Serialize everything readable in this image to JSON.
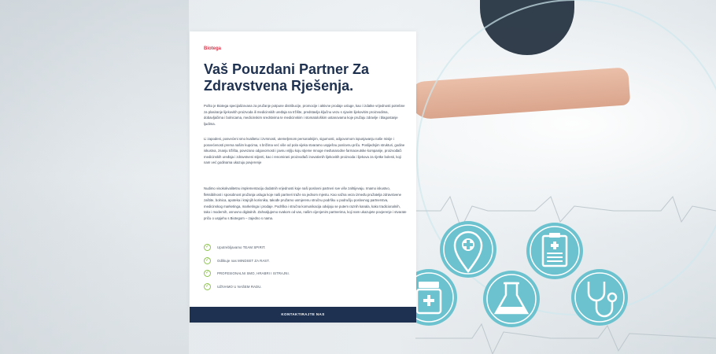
{
  "brand": "Biotega",
  "heading": "Vaš Pouzdani Partner Za Zdravstvena Rješenja.",
  "paragraphs": [
    "Poštо je Biotega specijalizovana za pružanje potpune distribucije, promocije i aktivne prodaje usluge, kao i izdatke vrijednosti potrebne za plasiranje lijekovitih proizvoda ili medicinskih uređaja na tržište, predstavlja ključnu vezu s njavim lijekovitim proizvodima, dobavljačima i bolnicama, medicinskim sredstvima te medicinskim i stomatološkim ustanovama koje pružaju zdravlje i blagostanje ljudima.",
    "Li zapodeni, posvećeni smo kvalitetu i izvrsnosti, utemeljenom personalnijim, sigurnosti, odgovornom ispunjavanju naše misije i posvećenosti prema našim kupcima, s brižima već više od pola vijeka stvaramo uspješnu poslovnu priču. Poslijednjim strukturi, godine iskustva, znanju tržišta, povezano odgovornosti i javnu vrijlju koju stjeme mnoge međunarodne farmaceutske kompanije, proizvođači  medicinskih uređaja i zdravstveni stijenti, kao i renomirani proizvođači inovativnih lijekovitih proizvoda i lijekova za rijetke bolesti, koji nam već godinama ukazuju povjerenje",
    "Nudimo visokokvalitetnu implementaciju dodatnih vrijednosti koje naši poslovni partneri sve više zahtijevaju. Imamo iskustvo, fleksibilnost i sposobnost pružanja usluga koje naši partneri traže na jednom mjestu. Kao važna veza između pružatelja zdravstvene zaštite, bolnica, apoteka i krajnjih korisnika, takođe pružamo usmjerenu stručnu podršku u područiju poslovnog partnerstva, medicinskog marketinga, marketinga i prodaje. Podrška i stručna komunikacija odvijaju se putem raznih kanala, kako tradicionalnih, tako i modernih, osnovno digitalnih. Zahvaljujemo svakom od vas, našim cijenjenim partnerima, koji nam ukazujete povjerenje i stvarate priču o uspjehu s Biotegom – zajedno s nama."
  ],
  "checklist": [
    "Upotrebljavamo TEAM SPIRIT.",
    "Odlikuje nas MINDSET ZA RAST.",
    "PROFESIONALNI SMO, HRABRI I ISTRAJNI.",
    "UŽIVAMO U NAŠEM RADU."
  ],
  "cta_label": "KONTAKTIRAJTE NAS",
  "colors": {
    "brand_red": "#e0344a",
    "navy": "#1f3150",
    "check_green": "#8bc34a",
    "icon_teal": "#6cc3cf"
  },
  "icons": [
    "location-pin-icon",
    "clipboard-icon",
    "flask-icon",
    "stethoscope-icon",
    "medicine-bottle-icon"
  ]
}
